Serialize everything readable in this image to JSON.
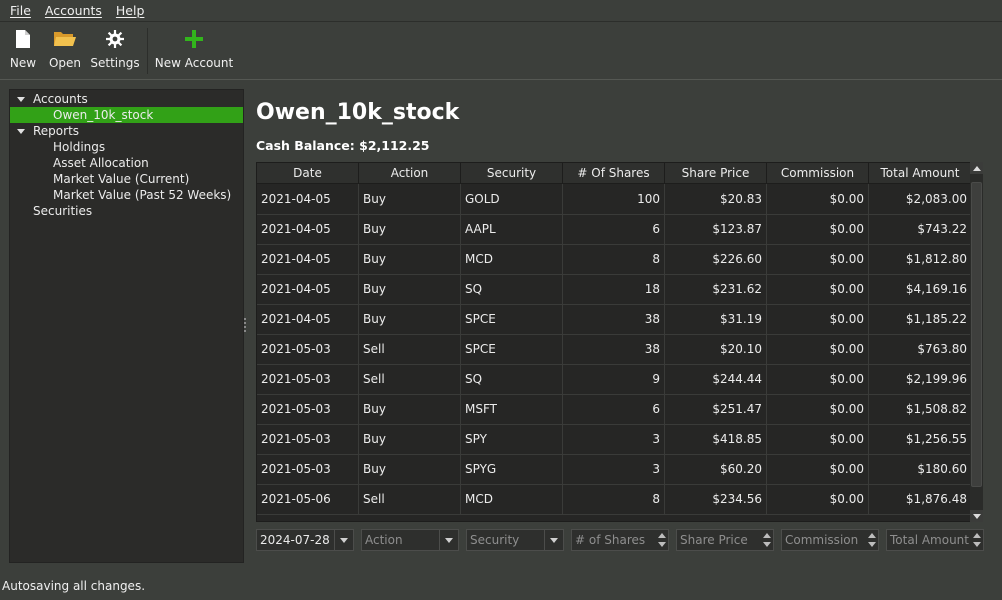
{
  "menu": {
    "file": "File",
    "accounts": "Accounts",
    "help": "Help"
  },
  "toolbar": {
    "new": "New",
    "open": "Open",
    "settings": "Settings",
    "new_account": "New Account"
  },
  "tree": {
    "accounts": "Accounts",
    "account_item": "Owen_10k_stock",
    "reports": "Reports",
    "holdings": "Holdings",
    "asset_allocation": "Asset Allocation",
    "market_value_current": "Market Value (Current)",
    "market_value_52": "Market Value (Past 52 Weeks)",
    "securities": "Securities"
  },
  "account": {
    "title": "Owen_10k_stock",
    "cash_balance": "Cash Balance: $2,112.25"
  },
  "table": {
    "columns": [
      "Date",
      "Action",
      "Security",
      "# Of Shares",
      "Share Price",
      "Commission",
      "Total Amount"
    ],
    "rows": [
      [
        "2021-04-05",
        "Buy",
        "GOLD",
        "100",
        "$20.83",
        "$0.00",
        "$2,083.00"
      ],
      [
        "2021-04-05",
        "Buy",
        "AAPL",
        "6",
        "$123.87",
        "$0.00",
        "$743.22"
      ],
      [
        "2021-04-05",
        "Buy",
        "MCD",
        "8",
        "$226.60",
        "$0.00",
        "$1,812.80"
      ],
      [
        "2021-04-05",
        "Buy",
        "SQ",
        "18",
        "$231.62",
        "$0.00",
        "$4,169.16"
      ],
      [
        "2021-04-05",
        "Buy",
        "SPCE",
        "38",
        "$31.19",
        "$0.00",
        "$1,185.22"
      ],
      [
        "2021-05-03",
        "Sell",
        "SPCE",
        "38",
        "$20.10",
        "$0.00",
        "$763.80"
      ],
      [
        "2021-05-03",
        "Sell",
        "SQ",
        "9",
        "$244.44",
        "$0.00",
        "$2,199.96"
      ],
      [
        "2021-05-03",
        "Buy",
        "MSFT",
        "6",
        "$251.47",
        "$0.00",
        "$1,508.82"
      ],
      [
        "2021-05-03",
        "Buy",
        "SPY",
        "3",
        "$418.85",
        "$0.00",
        "$1,256.55"
      ],
      [
        "2021-05-03",
        "Buy",
        "SPYG",
        "3",
        "$60.20",
        "$0.00",
        "$180.60"
      ],
      [
        "2021-05-06",
        "Sell",
        "MCD",
        "8",
        "$234.56",
        "$0.00",
        "$1,876.48"
      ]
    ]
  },
  "entry": {
    "date": "2024-07-28",
    "action_ph": "Action",
    "security_ph": "Security",
    "shares_ph": "# of Shares",
    "price_ph": "Share Price",
    "commission_ph": "Commission",
    "total_ph": "Total Amount"
  },
  "status": "Autosaving all changes.",
  "colors": {
    "accent": "#32a117",
    "background": "#3c3f3b",
    "panel": "#2b2b29"
  },
  "icons": [
    "new-file-icon",
    "open-folder-icon",
    "settings-gear-icon",
    "add-plus-icon"
  ]
}
